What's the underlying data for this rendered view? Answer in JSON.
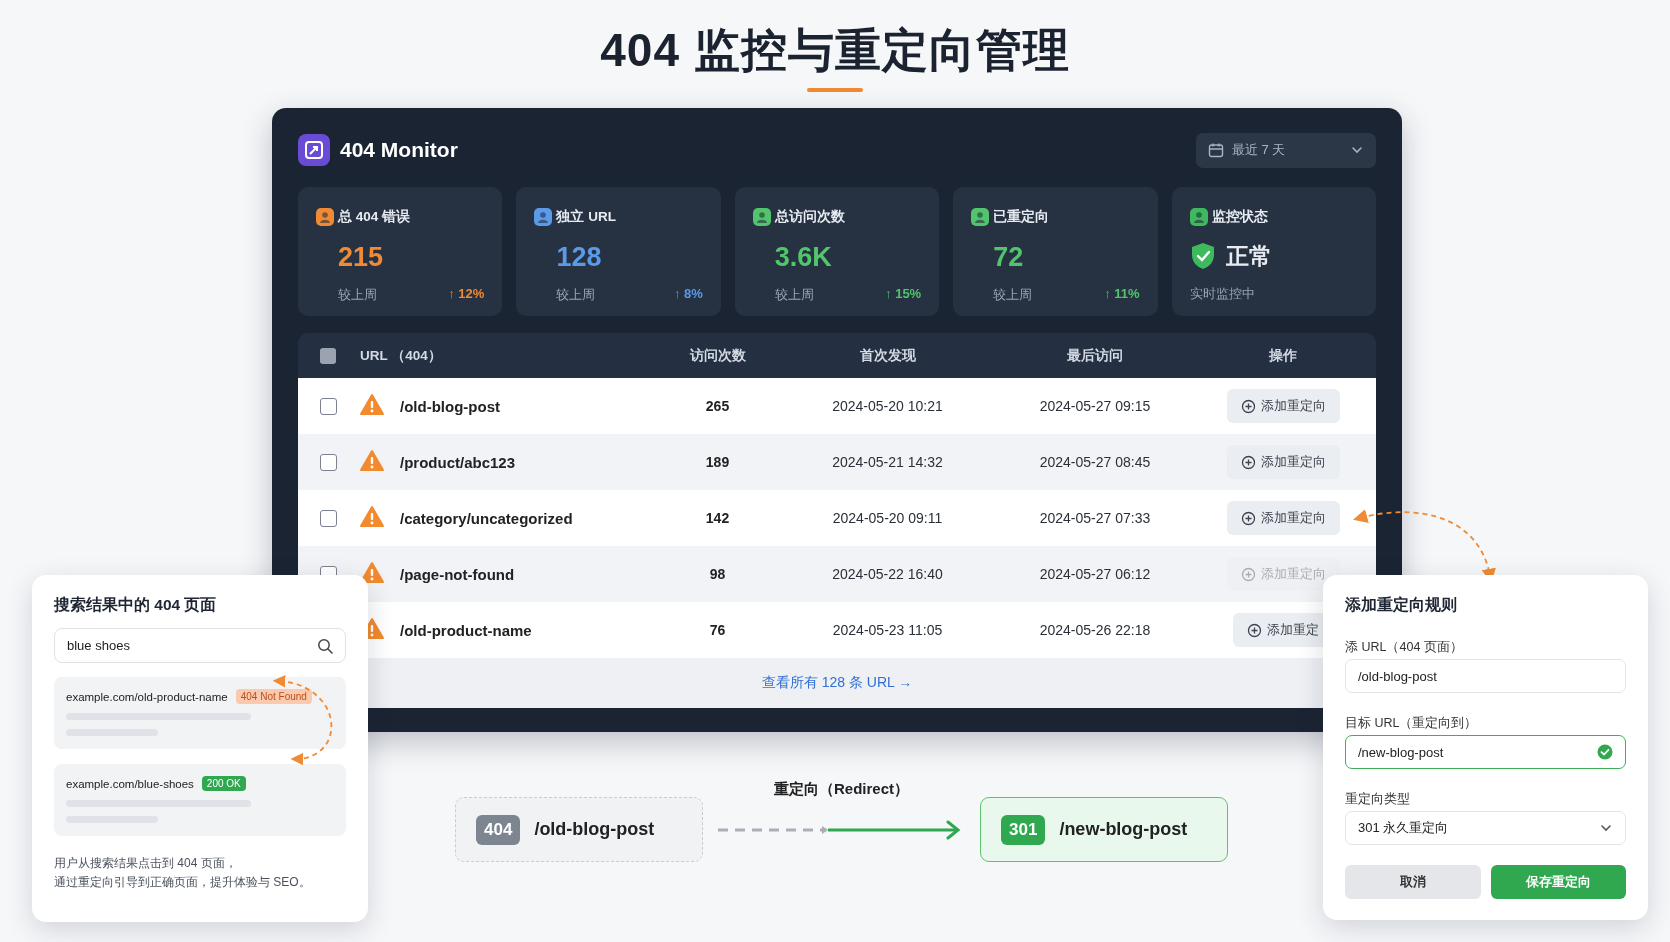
{
  "title": "404 监控与重定向管理",
  "dashboard": {
    "app_name": "404 Monitor",
    "date_range": "最近 7 天",
    "stats": [
      {
        "kind": "metric",
        "label": "总 404 错误",
        "value": "215",
        "compare": "较上周",
        "trend": "↑ 12%",
        "color": "#f08a34"
      },
      {
        "kind": "metric",
        "label": "独立 URL",
        "value": "128",
        "compare": "较上周",
        "trend": "↑ 8%",
        "color": "#5b9ae8"
      },
      {
        "kind": "metric",
        "label": "总访问次数",
        "value": "3.6K",
        "compare": "较上周",
        "trend": "↑ 15%",
        "color": "#52c46c"
      },
      {
        "kind": "metric",
        "label": "已重定向",
        "value": "72",
        "compare": "较上周",
        "trend": "↑ 11%",
        "color": "#52c46c"
      },
      {
        "kind": "status",
        "label": "监控状态",
        "value": "正常",
        "note": "实时监控中",
        "color": "#3fb95e"
      }
    ],
    "table": {
      "select_all_disabled": true,
      "columns": [
        "URL （404）",
        "访问次数",
        "首次发现",
        "最后访问",
        "操作"
      ],
      "rows": [
        {
          "checked": false,
          "url": "/old-blog-post",
          "visits": "265",
          "first_seen": "2024-05-20 10:21",
          "last_visit": "2024-05-27 09:15",
          "action": "添加重定向",
          "disabled": false
        },
        {
          "checked": false,
          "url": "/product/abc123",
          "visits": "189",
          "first_seen": "2024-05-21 14:32",
          "last_visit": "2024-05-27 08:45",
          "action": "添加重定向",
          "disabled": false
        },
        {
          "checked": false,
          "url": "/category/uncategorized",
          "visits": "142",
          "first_seen": "2024-05-20 09:11",
          "last_visit": "2024-05-27 07:33",
          "action": "添加重定向",
          "disabled": false
        },
        {
          "checked": false,
          "url": "/page-not-found",
          "visits": "98",
          "first_seen": "2024-05-22 16:40",
          "last_visit": "2024-05-27 06:12",
          "action": "添加重定向",
          "disabled": true
        },
        {
          "url": "/old-product-name",
          "visits": "76",
          "first_seen": "2024-05-23 11:05",
          "last_visit": "2024-05-26 22:18",
          "action": "添加重定",
          "disabled": false
        }
      ],
      "footer_link": "查看所有 128 条 URL →"
    }
  },
  "search_card": {
    "title": "搜索结果中的 404 页面",
    "query": "blue shoes",
    "results": [
      {
        "kind": "error",
        "url": "example.com/old-product-name",
        "badge": "404 Not Found"
      },
      {
        "kind": "ok",
        "url": "example.com/blue-shoes",
        "badge": "200 OK"
      }
    ],
    "note": [
      "用户从搜索结果点击到 404 页面，",
      "通过重定向引导到正确页面，提升体验与 SEO。"
    ]
  },
  "flow": {
    "source": {
      "code": "404",
      "path": "/old-blog-post"
    },
    "label": "重定向（Redirect）",
    "target": {
      "code": "301",
      "path": "/new-blog-post"
    }
  },
  "redirect_form": {
    "title": "添加重定向规则",
    "source_label": "添 URL（404 页面）",
    "source_value": "/old-blog-post",
    "target_label": "目标 URL（重定向到）",
    "target_value": "/new-blog-post",
    "target_valid": true,
    "type_label": "重定向类型",
    "type_value": "301 永久重定向",
    "buttons": [
      "取消",
      "保存重定向"
    ]
  }
}
